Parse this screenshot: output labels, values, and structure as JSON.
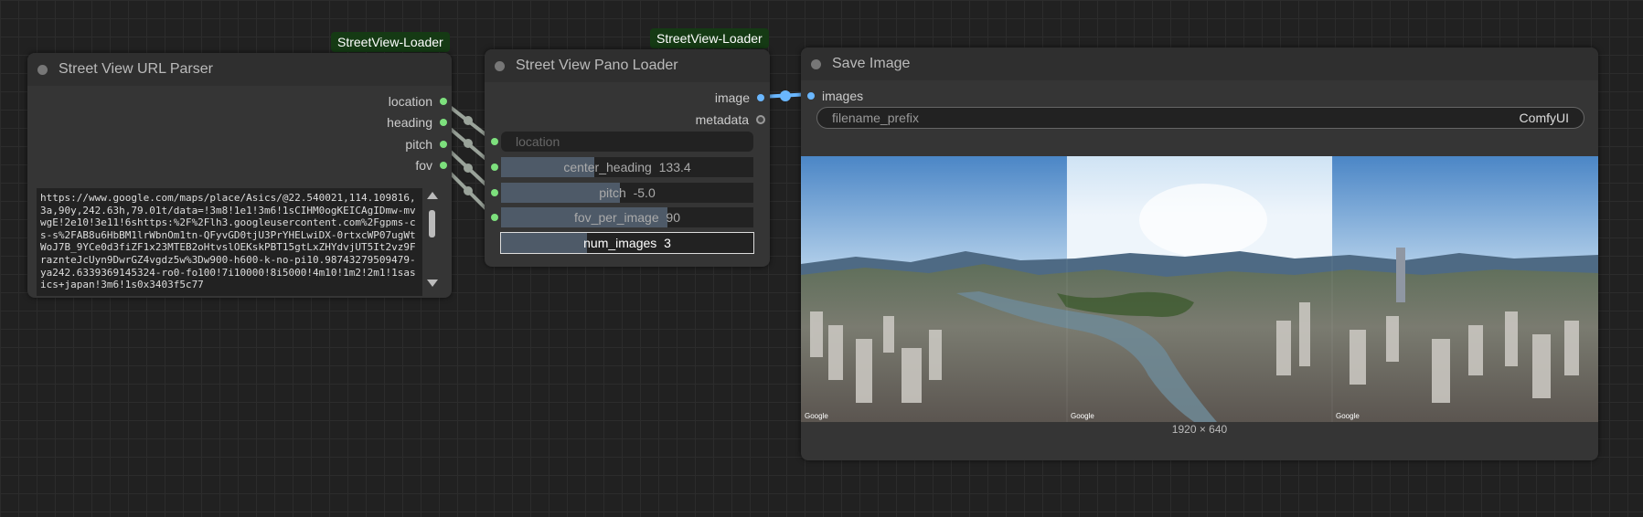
{
  "nodes": {
    "url_parser": {
      "badge": "StreetView-Loader",
      "title": "Street View URL Parser",
      "outputs": [
        "location",
        "heading",
        "pitch",
        "fov"
      ],
      "url_text": "https://www.google.com/maps/place/Asics/@22.540021,114.109816,3a,90y,242.63h,79.01t/data=!3m8!1e1!3m6!1sCIHM0ogKEICAgIDmw-mvwgE!2e10!3e11!6shttps:%2F%2Flh3.googleusercontent.com%2Fgpms-cs-s%2FAB8u6HbBM1lrWbnOm1tn-QFyvGD0tjU3PrYHELwiDX-0rtxcWP07ugWtWoJ7B_9YCe0d3fiZF1x23MTEB2oHtvslOEKskPBT15gtLxZHYdvjUT5It2vz9FraznteJcUyn9DwrGZ4vgdz5w%3Dw900-h600-k-no-pi10.98743279509479-ya242.6339369145324-ro0-fo100!7i10000!8i5000!4m10!1m2!2m1!1sasics+japan!3m6!1s0x3403f5c77"
    },
    "pano_loader": {
      "badge": "StreetView-Loader",
      "title": "Street View Pano Loader",
      "outputs": [
        "image",
        "metadata"
      ],
      "location_placeholder": "location",
      "center_heading": {
        "label": "center_heading",
        "value": "133.4",
        "fill": 0.37
      },
      "pitch": {
        "label": "pitch",
        "value": "-5.0",
        "fill": 0.47
      },
      "fov_per_image": {
        "label": "fov_per_image",
        "value": "90",
        "fill": 0.66
      },
      "num_images": {
        "label": "num_images",
        "value": "3",
        "fill": 0.34
      }
    },
    "save_image": {
      "title": "Save Image",
      "input": "images",
      "filename_prefix_label": "filename_prefix",
      "filename_prefix_value": "ComfyUI",
      "image_size": "1920 × 640",
      "watermarks": [
        "Google",
        "Google",
        "Google"
      ]
    }
  },
  "colors": {
    "badge_bg": "#153a14",
    "slot_green": "#7de07d",
    "link_blue": "#6ab7ff",
    "canvas_bg": "#212121",
    "node_bg": "#353535"
  }
}
